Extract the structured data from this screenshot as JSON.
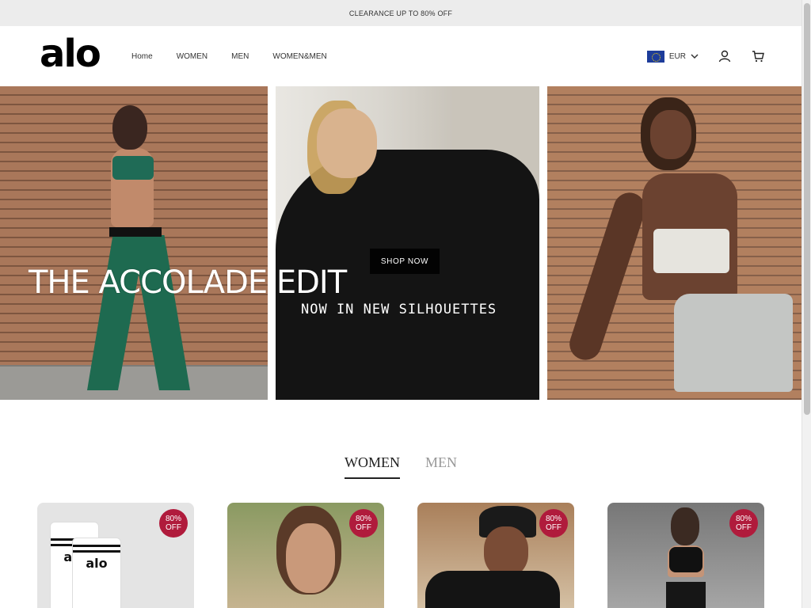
{
  "announcement": "CLEARANCE UP TO 80% OFF",
  "header": {
    "logo": "alo",
    "nav": [
      "Home",
      "WOMEN",
      "MEN",
      "WOMEN&MEN"
    ],
    "currency": "EUR",
    "icons": [
      "flag-eu-icon",
      "chevron-down-icon",
      "user-icon",
      "cart-icon"
    ]
  },
  "hero": {
    "title": "THE ACCOLADE  EDIT",
    "subtitle": "NOW IN NEW SILHOUETTES",
    "cta": "SHOP NOW"
  },
  "tabs": [
    {
      "label": "WOMEN",
      "active": true
    },
    {
      "label": "MEN",
      "active": false
    }
  ],
  "products": [
    {
      "badge_line1": "80%",
      "badge_line2": "OFF",
      "image_text": "alo"
    },
    {
      "badge_line1": "80%",
      "badge_line2": "OFF"
    },
    {
      "badge_line1": "80%",
      "badge_line2": "OFF"
    },
    {
      "badge_line1": "80%",
      "badge_line2": "OFF"
    }
  ],
  "colors": {
    "badge": "#b01b3c",
    "announcement_bg": "#ececec",
    "button_bg": "#111111"
  }
}
